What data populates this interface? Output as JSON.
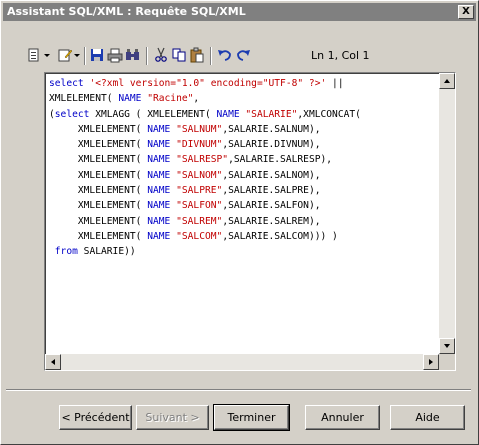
{
  "window": {
    "title": "Assistant SQL/XML : Requête SQL/XML",
    "close_label": "X"
  },
  "toolbar": {
    "icons": [
      "document-list-icon",
      "chevron-down-icon",
      "edit-icon",
      "chevron-down-icon",
      "save-icon",
      "print-icon",
      "find-icon",
      "cut-icon",
      "copy-icon",
      "paste-icon",
      "undo-icon",
      "redo-icon"
    ],
    "position_text": "Ln 1, Col 1"
  },
  "editor": {
    "lines": [
      [
        {
          "t": "select ",
          "c": "kw"
        },
        {
          "t": "'<?xml version=\"1.0\" encoding=\"UTF-8\" ?>'",
          "c": "str"
        },
        {
          "t": " ||",
          "c": ""
        }
      ],
      [
        {
          "t": "XMLELEMENT( ",
          "c": ""
        },
        {
          "t": "NAME",
          "c": "kw"
        },
        {
          "t": " ",
          "c": ""
        },
        {
          "t": "\"Racine\"",
          "c": "str"
        },
        {
          "t": ",",
          "c": ""
        }
      ],
      [
        {
          "t": "(",
          "c": ""
        },
        {
          "t": "select",
          "c": "kw"
        },
        {
          "t": " XMLAGG ( XMLELEMENT( ",
          "c": ""
        },
        {
          "t": "NAME",
          "c": "kw"
        },
        {
          "t": " ",
          "c": ""
        },
        {
          "t": "\"SALARIE\"",
          "c": "str"
        },
        {
          "t": ",XMLCONCAT(",
          "c": ""
        }
      ],
      [
        {
          "t": "     XMLELEMENT( ",
          "c": ""
        },
        {
          "t": "NAME",
          "c": "kw"
        },
        {
          "t": " ",
          "c": ""
        },
        {
          "t": "\"SALNUM\"",
          "c": "str"
        },
        {
          "t": ",SALARIE.SALNUM),",
          "c": ""
        }
      ],
      [
        {
          "t": "     XMLELEMENT( ",
          "c": ""
        },
        {
          "t": "NAME",
          "c": "kw"
        },
        {
          "t": " ",
          "c": ""
        },
        {
          "t": "\"DIVNUM\"",
          "c": "str"
        },
        {
          "t": ",SALARIE.DIVNUM),",
          "c": ""
        }
      ],
      [
        {
          "t": "     XMLELEMENT( ",
          "c": ""
        },
        {
          "t": "NAME",
          "c": "kw"
        },
        {
          "t": " ",
          "c": ""
        },
        {
          "t": "\"SALRESP\"",
          "c": "str"
        },
        {
          "t": ",SALARIE.SALRESP),",
          "c": ""
        }
      ],
      [
        {
          "t": "     XMLELEMENT( ",
          "c": ""
        },
        {
          "t": "NAME",
          "c": "kw"
        },
        {
          "t": " ",
          "c": ""
        },
        {
          "t": "\"SALNOM\"",
          "c": "str"
        },
        {
          "t": ",SALARIE.SALNOM),",
          "c": ""
        }
      ],
      [
        {
          "t": "     XMLELEMENT( ",
          "c": ""
        },
        {
          "t": "NAME",
          "c": "kw"
        },
        {
          "t": " ",
          "c": ""
        },
        {
          "t": "\"SALPRE\"",
          "c": "str"
        },
        {
          "t": ",SALARIE.SALPRE),",
          "c": ""
        }
      ],
      [
        {
          "t": "     XMLELEMENT( ",
          "c": ""
        },
        {
          "t": "NAME",
          "c": "kw"
        },
        {
          "t": " ",
          "c": ""
        },
        {
          "t": "\"SALFON\"",
          "c": "str"
        },
        {
          "t": ",SALARIE.SALFON),",
          "c": ""
        }
      ],
      [
        {
          "t": "     XMLELEMENT( ",
          "c": ""
        },
        {
          "t": "NAME",
          "c": "kw"
        },
        {
          "t": " ",
          "c": ""
        },
        {
          "t": "\"SALREM\"",
          "c": "str"
        },
        {
          "t": ",SALARIE.SALREM),",
          "c": ""
        }
      ],
      [
        {
          "t": "     XMLELEMENT( ",
          "c": ""
        },
        {
          "t": "NAME",
          "c": "kw"
        },
        {
          "t": " ",
          "c": ""
        },
        {
          "t": "\"SALCOM\"",
          "c": "str"
        },
        {
          "t": ",SALARIE.SALCOM))) )",
          "c": ""
        }
      ],
      [
        {
          "t": " ",
          "c": ""
        },
        {
          "t": "from",
          "c": "kw"
        },
        {
          "t": " SALARIE))",
          "c": ""
        }
      ]
    ]
  },
  "buttons": {
    "previous": "< Précédent",
    "next": "Suivant >",
    "finish": "Terminer",
    "cancel": "Annuler",
    "help": "Aide"
  },
  "colors": {
    "keyword": "#0000c8",
    "string": "#c00000",
    "titlebar": "#808080",
    "face": "#d4d0c8"
  }
}
